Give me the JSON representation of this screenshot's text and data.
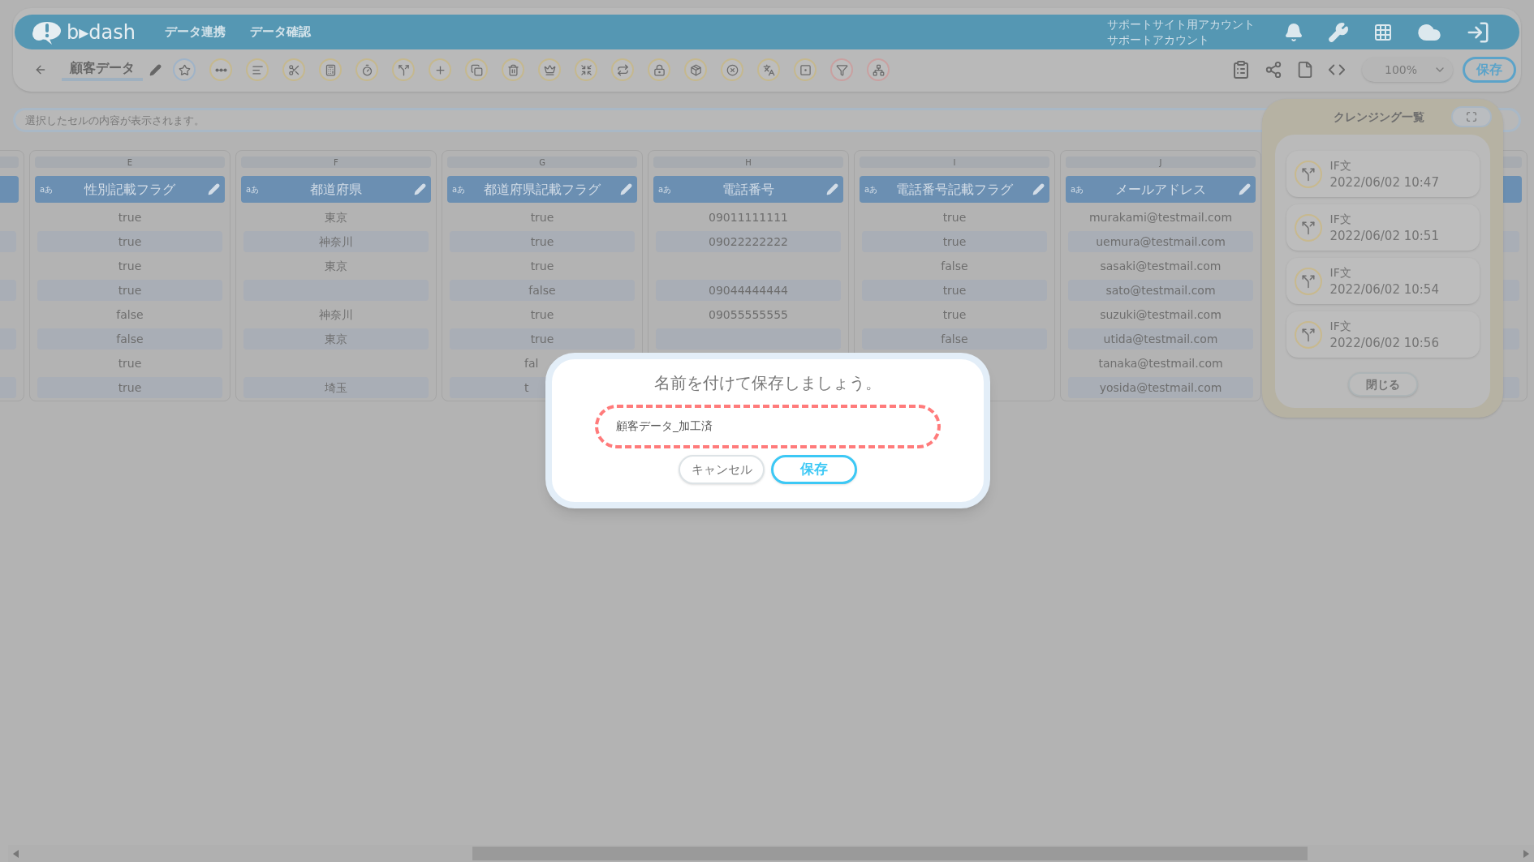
{
  "header": {
    "logo": "b▸dash",
    "nav": [
      {
        "label": "データ連携"
      },
      {
        "label": "データ確認"
      }
    ],
    "account": [
      "サポートサイト用アカウント",
      "サポートアカウント"
    ]
  },
  "toolbar": {
    "title": "顧客データ",
    "zoom": "100%",
    "save": "保存"
  },
  "cell_display": {
    "placeholder": "選択したセルの内容が表示されます。"
  },
  "columns": [
    {
      "letter": "E",
      "type_label": "aあ",
      "name": "性別記載フラグ",
      "cells": [
        "true",
        "true",
        "true",
        "true",
        "false",
        "false",
        "true",
        "true"
      ]
    },
    {
      "letter": "F",
      "type_label": "aあ",
      "name": "都道府県",
      "cells": [
        "東京",
        "神奈川",
        "東京",
        null,
        "神奈川",
        "東京",
        null,
        "埼玉"
      ]
    },
    {
      "letter": "G",
      "type_label": "aあ",
      "name": "都道府県記載フラグ",
      "cells": [
        "true",
        "true",
        "true",
        "false",
        "true",
        "true",
        {
          "text": "fal",
          "clipped": true
        },
        {
          "text": "t",
          "clipped": true
        }
      ]
    },
    {
      "letter": "H",
      "type_label": "aあ",
      "name": "電話番号",
      "cells": [
        "09011111111",
        "09022222222",
        null,
        "09044444444",
        "09055555555",
        null
      ]
    },
    {
      "letter": "I",
      "type_label": "aあ",
      "name": "電話番号記載フラグ",
      "cells": [
        "true",
        "true",
        "false",
        "true",
        "true",
        "false"
      ]
    },
    {
      "letter": "J",
      "type_label": "aあ",
      "name": "メールアドレス",
      "cells": [
        "murakami@testmail.com",
        "uemura@testmail.com",
        "sasaki@testmail.com",
        "sato@testmail.com",
        "suzuki@testmail.com",
        "utida@testmail.com",
        "tanaka@testmail.com",
        "yosida@testmail.com"
      ]
    }
  ],
  "cleansing_panel": {
    "title": "クレンジング一覧",
    "items": [
      {
        "name": "IF文",
        "time": "2022/06/02 10:47"
      },
      {
        "name": "IF文",
        "time": "2022/06/02 10:51"
      },
      {
        "name": "IF文",
        "time": "2022/06/02 10:54"
      },
      {
        "name": "IF文",
        "time": "2022/06/02 10:56"
      }
    ],
    "close": "閉じる"
  },
  "dialog": {
    "title": "名前を付けて保存しましょう。",
    "value": "顧客データ_加工済",
    "cancel": "キャンセル",
    "save": "保存"
  }
}
